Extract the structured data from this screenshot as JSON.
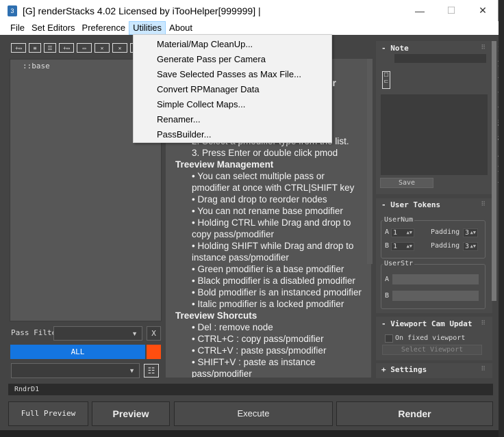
{
  "window": {
    "icon_text": "3",
    "title": "[G] renderStacks 4.02 Licensed by iTooHelper[999999] |",
    "min_glyph": "—",
    "max_glyph": "☐",
    "close_glyph": "✕"
  },
  "menubar": {
    "items": [
      "File",
      "Set Editors",
      "Preference",
      "Utilities",
      "About"
    ],
    "active": "Utilities"
  },
  "utilities_menu": {
    "items": [
      "Material/Map CleanUp...",
      "Generate Pass per Camera",
      "Save Selected Passes as Max File...",
      "Convert RPManager Data",
      "Simple Collect Maps...",
      "Renamer...",
      "PassBuilder..."
    ]
  },
  "toolbar": {
    "buttons": [
      "+▭",
      "≡",
      "☰",
      "+▭",
      "▭",
      "✕",
      "✕",
      "▭",
      "▭"
    ]
  },
  "tree": {
    "root_node": "::base"
  },
  "help": {
    "partial_heading": "er",
    "step2_partial": "2. Select a pmodifier type from the list.",
    "step3": "3. Press Enter or double click pmod",
    "treeview_mgmt_title": "Treeview Management",
    "tm_lines": [
      "• You can select multiple pass or",
      "pmodifier at once with CTRL|SHIFT key",
      "• Drag and drop to reorder nodes",
      "• You can not rename base pmodifier",
      "• Holding CTRL while Drag and drop to",
      "copy pass/pmodifier",
      "• Holding SHIFT while Drag and drop to",
      "instance pass/pmodifier",
      "• Green pmodifier is a base pmodifier",
      "• Black pmodifier is a disabled pmodifier",
      "• Bold pmodifier is an instanced pmodifier",
      "• Italic pmodifier is a locked pmodifier"
    ],
    "shortcuts_title": "Treeview Shorcuts",
    "sc_lines": [
      "• Del : remove node",
      "• CTRL+C : copy pass/pmodifier",
      "• CTRL+V : paste pass/pmodifier",
      "• SHIFT+V : paste as instance",
      "pass/pmodifier"
    ]
  },
  "pass_filter": {
    "label": "Pass Filte",
    "clear_label": "X",
    "all_label": "ALL"
  },
  "note_panel": {
    "title": "Note",
    "toggle": "-",
    "save_label": "Save"
  },
  "user_tokens": {
    "title": "User Tokens",
    "toggle": "-",
    "usernum_label": "UserNum",
    "a_label": "A",
    "a_value": "1",
    "b_label": "B",
    "b_value": "1",
    "padding_label": "Padding",
    "padding_a": "3",
    "padding_b": "3",
    "userstr_label": "UserStr",
    "str_a_label": "A",
    "str_b_label": "B"
  },
  "viewport_cam": {
    "title": "Viewport Cam Updat",
    "toggle": "-",
    "checkbox_label": "On fixed viewport",
    "select_label": "Select Viewport"
  },
  "settings": {
    "title": "Settings",
    "toggle": "+"
  },
  "status": {
    "text": "RndrD1"
  },
  "bottom_buttons": {
    "full_preview": "Full Preview",
    "preview": "Preview",
    "execute": "Execute",
    "render": "Render"
  },
  "side_chars": [
    "角",
    "如",
    "化",
    "色",
    "设",
    "精",
    "标",
    "度",
    "文",
    "设"
  ],
  "colors": {
    "all_bar": "#1475e0",
    "orange_swatch": "#ff4e0f",
    "menu_highlight": "#cce8ff"
  }
}
